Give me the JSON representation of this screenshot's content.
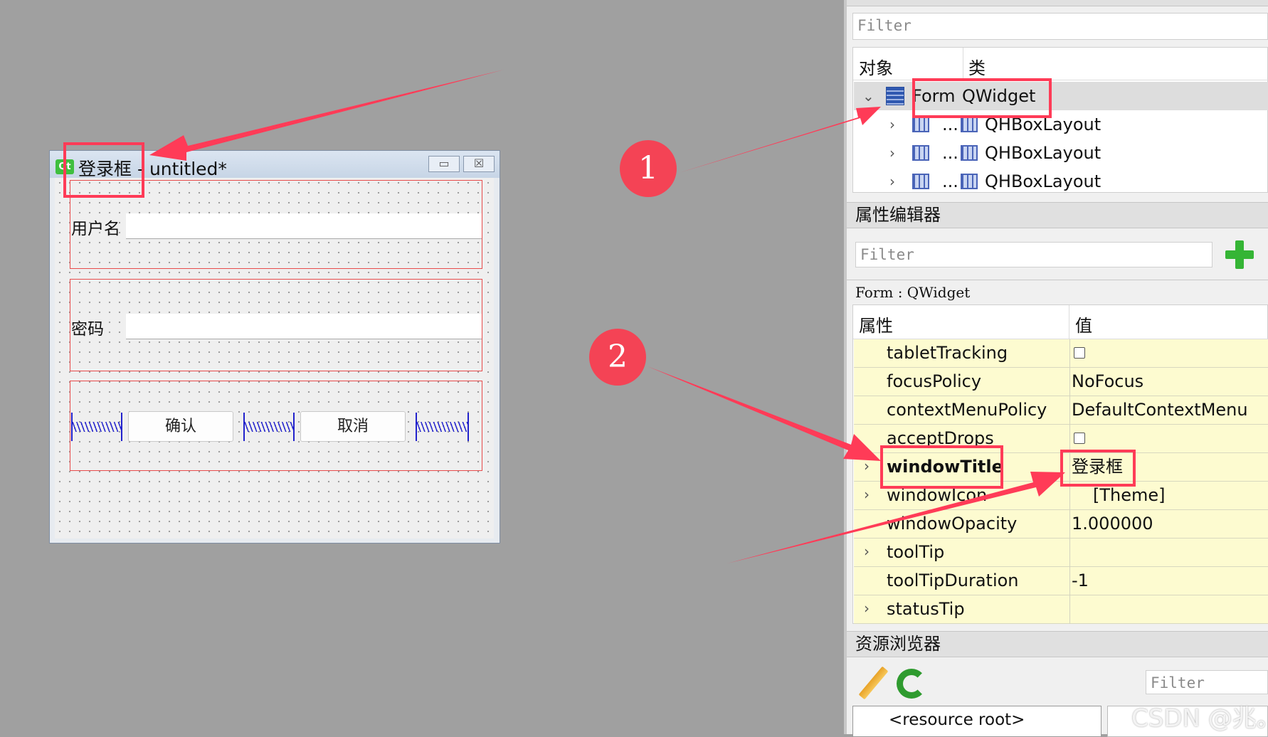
{
  "form_window": {
    "title_name": "登录框",
    "title_sep": "-",
    "title_file": "untitled*",
    "logo_text": "Qt",
    "minimize_glyph": "▭",
    "close_glyph": "☒",
    "username_label": "用户名",
    "password_label": "密码",
    "ok_button": "确认",
    "cancel_button": "取消"
  },
  "object_inspector": {
    "filter_placeholder": "Filter",
    "col_object": "对象",
    "col_class": "类",
    "rows": [
      {
        "name": "Form",
        "class": "QWidget"
      },
      {
        "name": "...",
        "class": "QHBoxLayout"
      },
      {
        "name": "...",
        "class": "QHBoxLayout"
      },
      {
        "name": "...",
        "class": "QHBoxLayout"
      }
    ]
  },
  "property_editor": {
    "title": "属性编辑器",
    "filter_placeholder": "Filter",
    "context": "Form : QWidget",
    "col_property": "属性",
    "col_value": "值",
    "rows": [
      {
        "name": "tabletTracking",
        "value": ""
      },
      {
        "name": "focusPolicy",
        "value": "NoFocus"
      },
      {
        "name": "contextMenuPolicy",
        "value": "DefaultContextMenu"
      },
      {
        "name": "acceptDrops",
        "value": ""
      },
      {
        "name": "windowTitle",
        "value": "登录框"
      },
      {
        "name": "windowIcon",
        "value": "[Theme]"
      },
      {
        "name": "windowOpacity",
        "value": "1.000000"
      },
      {
        "name": "toolTip",
        "value": ""
      },
      {
        "name": "toolTipDuration",
        "value": "-1"
      },
      {
        "name": "statusTip",
        "value": ""
      }
    ]
  },
  "resource_browser": {
    "title": "资源浏览器",
    "filter_placeholder": "Filter",
    "root_item": "<resource root>"
  },
  "annotations": {
    "callout_1": "1",
    "callout_2": "2",
    "highlight_color": "#ff3b57"
  },
  "watermark": "CSDN @兆。"
}
